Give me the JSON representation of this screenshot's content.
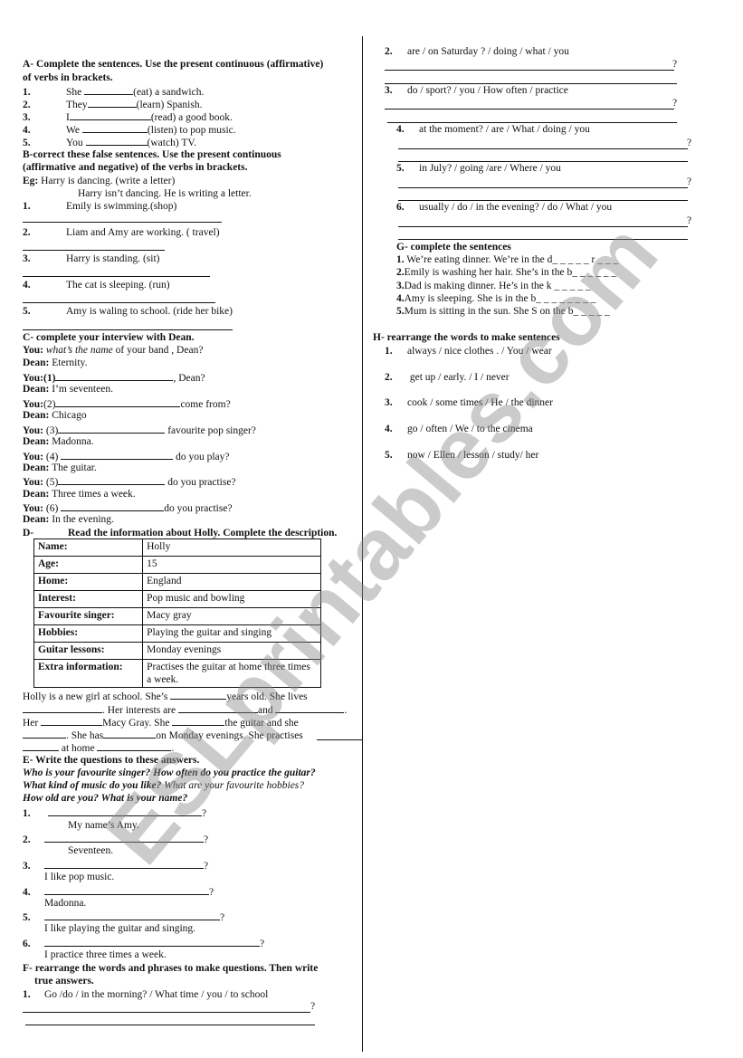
{
  "watermark": "ESLprintables.com",
  "sectionA": {
    "title": "A-    Complete the sentences. Use the present continuous (affirmative)",
    "title2": "of verbs in brackets.",
    "items": [
      {
        "num": "1.",
        "pre": "She",
        "post": "(eat) a sandwich."
      },
      {
        "num": "2.",
        "pre": "They",
        "post": "(learn) Spanish."
      },
      {
        "num": "3.",
        "pre": "I",
        "post": "(read) a good book."
      },
      {
        "num": "4.",
        "pre": "We",
        "post": "(listen) to pop music."
      },
      {
        "num": "5.",
        "pre": "You",
        "post": "(watch) TV."
      }
    ]
  },
  "sectionB": {
    "title": "B-correct these false sentences. Use the present continuous",
    "title2": "(affirmative and negative) of the verbs in brackets.",
    "eg_label": "Eg:",
    "eg_text": "Harry is dancing. (write a letter)",
    "eg_answer": "Harry isn’t dancing. He is writing a letter.",
    "items": [
      {
        "num": "1.",
        "text": "Emily is swimming.(shop)"
      },
      {
        "num": "2.",
        "text": "Liam and Amy are working. ( travel)"
      },
      {
        "num": "3.",
        "text": "Harry is standing. (sit)"
      },
      {
        "num": "4.",
        "text": "The cat is sleeping. (run)"
      },
      {
        "num": "5.",
        "text": "Amy is waling to school. (ride her bike)"
      }
    ]
  },
  "sectionC": {
    "title": "C-    complete your interview with Dean.",
    "you": "You:",
    "dean": "Dean:",
    "intro_q_italic": "what’s the name",
    "intro_q_rest": " of your band , Dean?",
    "intro_a": "Eternity.",
    "lines": [
      {
        "num": "(1)",
        "post": ", Dean?",
        "answer": "I’m seventeen."
      },
      {
        "num": "(2)",
        "post": "come from?",
        "answer": "Chicago"
      },
      {
        "num": "(3)",
        "post": "favourite pop singer?",
        "answer": "Madonna."
      },
      {
        "num": "(4)",
        "post": "do you play?",
        "answer": "The guitar."
      },
      {
        "num": "(5)",
        "post": "do you practise?",
        "answer": "Three times a week."
      },
      {
        "num": "(6)",
        "post": "do you practise?",
        "answer": "In the evening."
      }
    ]
  },
  "sectionD": {
    "title_prefix": "D-",
    "title": "Read the information about Holly. Complete the description.",
    "table": [
      {
        "label": "Name:",
        "value": "Holly"
      },
      {
        "label": "Age:",
        "value": "15"
      },
      {
        "label": "Home:",
        "value": "England"
      },
      {
        "label": "Interest:",
        "value": "Pop music and bowling"
      },
      {
        "label": "Favourite singer:",
        "value": "Macy gray"
      },
      {
        "label": "Hobbies:",
        "value": "Playing the guitar and singing"
      },
      {
        "label": "Guitar lessons:",
        "value": "Monday evenings"
      },
      {
        "label": "Extra information:",
        "value": "Practises the guitar at home three times a week."
      }
    ],
    "p1a": "Holly is a new girl at school. She’s",
    "p1b": "years old. She lives",
    "p2a": ". Her interests are",
    "p2b": "and",
    "p2c": ".",
    "p3a": "Her",
    "p3b": "Macy Gray. She",
    "p3c": "the guitar and she",
    "p4a": ". She has",
    "p4b": "on Monday evenings. She practises",
    "p5a": "at home",
    "p5b": "."
  },
  "sectionE": {
    "title": "E-    Write the questions to these answers.",
    "hints1": "Who is your favourite singer?  How often do you practice the guitar?",
    "hints2a": "What kind of music do you like?",
    "hints2b": "  What are your favourite hobbies?",
    "hints3": "How old are you? What is your name?",
    "items": [
      {
        "num": "1.",
        "answer": "My name’s Amy."
      },
      {
        "num": "2.",
        "answer": "Seventeen."
      },
      {
        "num": "3.",
        "answer": "I like pop music."
      },
      {
        "num": "4.",
        "answer": "Madonna."
      },
      {
        "num": "5.",
        "answer": "I like  playing the guitar and singing."
      },
      {
        "num": "6.",
        "answer": "I practice three times a week."
      }
    ],
    "qmark": "?"
  },
  "sectionF": {
    "title": "F- rearrange the words and phrases to make questions. Then write",
    "title2": "true answers.",
    "items": [
      {
        "num": "1.",
        "text": "Go  /do   / in the morning?  / What time  / you /  to school"
      },
      {
        "num": "2.",
        "text": "are    / on Saturday ? / doing  / what  / you"
      },
      {
        "num": "3.",
        "text": "do  / sport?  / you   / How often   / practice"
      },
      {
        "num": "4.",
        "text": "at the moment? / are   / What / doing    / you"
      },
      {
        "num": "5.",
        "text": "in July?  / going   /are   / Where  / you"
      },
      {
        "num": "6.",
        "text": "usually  /  do  / in the evening?  / do   / What  / you"
      }
    ],
    "qmark": "?"
  },
  "sectionG": {
    "title": "G-       complete the sentences",
    "items": [
      {
        "num": "1.",
        "text": " We’re eating dinner. We’re in the d_ _ _ _ _ r _ _ _"
      },
      {
        "num": "2.",
        "text": "Emily is washing her hair. She’s in the b_ _ _ _ _ _"
      },
      {
        "num": "3.",
        "text": "Dad is making dinner. He’s in the k _ _ _ _ _"
      },
      {
        "num": "4.",
        "text": "Amy is sleeping. She is in the b_ _ _ _ _ _ _ _"
      },
      {
        "num": "5.",
        "text": "Mum is sitting in the sun. She S on the b_ _ _ _ _"
      }
    ]
  },
  "sectionH": {
    "title": "H-    rearrange the words to make sentences",
    "items": [
      {
        "num": "1.",
        "text": "always / nice clothes .  / You  / wear"
      },
      {
        "num": "2.",
        "text": " get up /  early.  / I  / never"
      },
      {
        "num": "3.",
        "text": "cook / some times / He  / the dinner"
      },
      {
        "num": "4.",
        "text": "go  / often / We / to the cinema"
      },
      {
        "num": "5.",
        "text": "now / Ellen / lesson / study/ her"
      }
    ]
  }
}
